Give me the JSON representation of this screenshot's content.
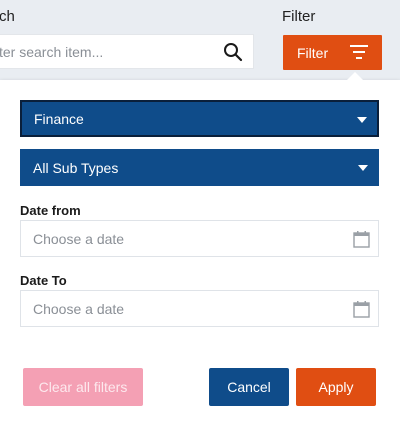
{
  "header": {
    "search_label": "ch",
    "filter_label": "Filter"
  },
  "search": {
    "placeholder": "ter search item...",
    "value": ""
  },
  "filter_button": {
    "label": "Filter"
  },
  "filter_panel": {
    "type_select": {
      "selected": "Finance"
    },
    "subtype_select": {
      "selected": "All Sub Types"
    },
    "date_from": {
      "label": "Date from",
      "placeholder": "Choose a date"
    },
    "date_to": {
      "label": "Date To",
      "placeholder": "Choose a date"
    },
    "buttons": {
      "clear": "Clear all filters",
      "cancel": "Cancel",
      "apply": "Apply"
    }
  },
  "colors": {
    "accent": "#e04e12",
    "primary": "#0f4c8a",
    "clear_disabled": "#f4a0b4",
    "background": "#e9edf2"
  },
  "icons": [
    "search-icon",
    "filter-lines-icon",
    "chevron-down-icon",
    "calendar-icon"
  ]
}
